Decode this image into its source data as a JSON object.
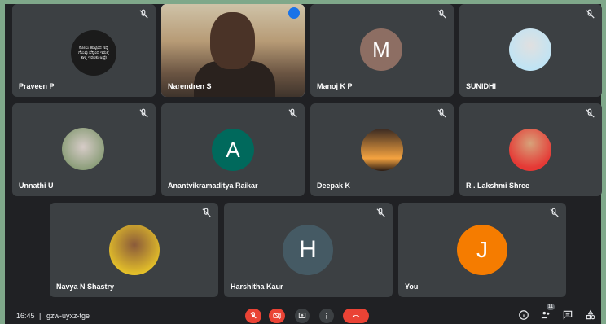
{
  "participants": [
    {
      "name": "Praveen P",
      "avatar_type": "image",
      "avatar_text": "ಸೋಲು ಹುಟ್ಟಿಂದ ಇದ್ದೆ ಗೆಲುವು ಬೆನ್ನಿಂದ ಇರುತ್ತೆ ತಾಳ್ಮೆ ಇರಲಕು ಅಷ್ಟೇ",
      "muted": true
    },
    {
      "name": "Narendren S",
      "avatar_type": "video",
      "muted": false,
      "speaking": true
    },
    {
      "name": "Manoj K P",
      "avatar_type": "letter",
      "avatar_letter": "M",
      "avatar_color": "#8d6e63",
      "muted": true
    },
    {
      "name": "SUNIDHI",
      "avatar_type": "image",
      "muted": true
    },
    {
      "name": "Unnathi U",
      "avatar_type": "image",
      "muted": true
    },
    {
      "name": "Anantvikramaditya Raikar",
      "avatar_type": "letter",
      "avatar_letter": "A",
      "avatar_color": "#00695c",
      "muted": true
    },
    {
      "name": "Deepak K",
      "avatar_type": "image",
      "muted": true
    },
    {
      "name": "R . Lakshmi Shree",
      "avatar_type": "image",
      "muted": true
    },
    {
      "name": "Navya N Shastry",
      "avatar_type": "image",
      "muted": true
    },
    {
      "name": "Harshitha Kaur",
      "avatar_type": "letter",
      "avatar_letter": "H",
      "avatar_color": "#455a64",
      "muted": true
    },
    {
      "name": "You",
      "avatar_type": "letter",
      "avatar_letter": "J",
      "avatar_color": "#f57c00",
      "muted": true
    }
  ],
  "bottom_bar": {
    "time": "16:45",
    "meeting_code": "gzw-uyxz-tge",
    "participant_count": "11"
  },
  "colors": {
    "background": "#202124",
    "tile": "#3c4043",
    "accent": "#8ab4f8",
    "danger": "#ea4335"
  }
}
